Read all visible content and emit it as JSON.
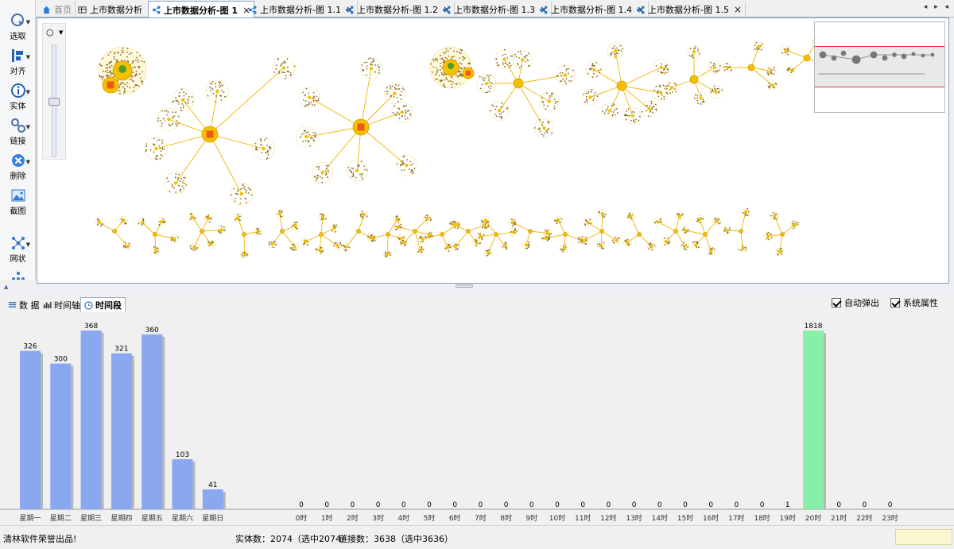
{
  "tabs": [
    {
      "label": "首页",
      "icon": "home-icon",
      "active": false
    },
    {
      "label": "上市数据分析",
      "icon": "table-icon",
      "active": false
    },
    {
      "label": "上市数据分析-图 1",
      "icon": "share-icon",
      "active": true
    },
    {
      "label": "上市数据分析-图 1.1",
      "icon": "share-icon",
      "active": false
    },
    {
      "label": "上市数据分析-图 1.2",
      "icon": "share-icon",
      "active": false
    },
    {
      "label": "上市数据分析-图 1.3",
      "icon": "share-icon",
      "active": false
    },
    {
      "label": "上市数据分析-图 1.4",
      "icon": "share-icon",
      "active": false
    },
    {
      "label": "上市数据分析-图 1.5",
      "icon": "share-icon",
      "active": false
    }
  ],
  "tab_close": "×",
  "tab_nav": "◂ ▸ ◂",
  "toolbar": {
    "items": [
      {
        "label": "选取",
        "icon": "select-icon"
      },
      {
        "label": "对齐",
        "icon": "align-icon"
      },
      {
        "label": "实体",
        "icon": "entity-info-icon"
      },
      {
        "label": "链接",
        "icon": "link-icon"
      },
      {
        "label": "删除",
        "icon": "delete-icon"
      },
      {
        "label": "截图",
        "icon": "screenshot-icon"
      },
      {
        "label": "网状",
        "icon": "network-layout-icon"
      }
    ]
  },
  "bottom_tabs": [
    {
      "label": "数 据",
      "icon": "list-icon",
      "active": false
    },
    {
      "label": "时间轴",
      "icon": "timeline-icon",
      "active": false
    },
    {
      "label": "时间段",
      "icon": "clock-icon",
      "active": true
    }
  ],
  "options": {
    "auto_popup": "自动弹出",
    "system_props": "系统属性"
  },
  "status": {
    "credit": "清林软件荣誉出品!",
    "entities": "实体数：2074（选中2074）",
    "links": "链接数：3638（选中3636）"
  },
  "colors": {
    "weekday_bar": "#8aa8f0",
    "hour_bar": "#88efa8",
    "node_yellow": "#f5c000",
    "edge": "#f0b400"
  },
  "chart_data": [
    {
      "type": "bar",
      "categories": [
        "星期一",
        "星期二",
        "星期三",
        "星期四",
        "星期五",
        "星期六",
        "星期日"
      ],
      "values": [
        326,
        300,
        368,
        321,
        360,
        103,
        41
      ],
      "ylim": [
        0,
        368
      ]
    },
    {
      "type": "bar",
      "categories": [
        "0时",
        "1时",
        "2时",
        "3时",
        "4时",
        "5时",
        "6时",
        "7时",
        "8时",
        "9时",
        "10时",
        "11时",
        "12时",
        "13时",
        "14时",
        "15时",
        "16时",
        "17时",
        "18时",
        "19时",
        "20时",
        "21时",
        "22时",
        "23时"
      ],
      "values": [
        0,
        0,
        0,
        0,
        0,
        0,
        0,
        0,
        0,
        0,
        0,
        0,
        0,
        0,
        0,
        0,
        0,
        0,
        0,
        1,
        1818,
        0,
        0,
        0
      ],
      "ylim": [
        0,
        1818
      ]
    }
  ]
}
